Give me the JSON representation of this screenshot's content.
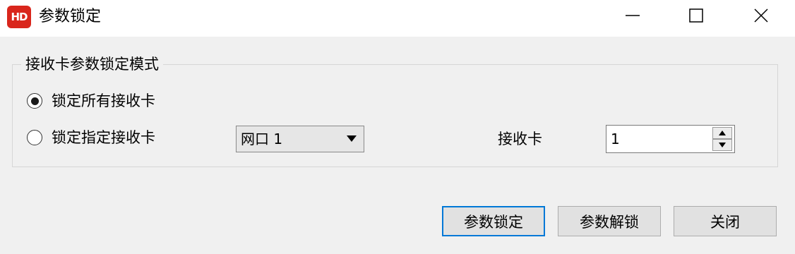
{
  "window": {
    "title": "参数锁定",
    "app_icon_text": "HD",
    "brand_color": "#d9261c"
  },
  "group": {
    "legend": "接收卡参数锁定模式",
    "options": [
      {
        "label": "锁定所有接收卡",
        "selected": true
      },
      {
        "label": "锁定指定接收卡",
        "selected": false
      }
    ],
    "port_select": {
      "value": "网口 1"
    },
    "receiver_card": {
      "label": "接收卡",
      "value": "1"
    }
  },
  "buttons": {
    "lock": "参数锁定",
    "unlock": "参数解锁",
    "close": "关闭",
    "focus_color": "#0078d7"
  },
  "icons": {
    "minimize": "minimize-icon",
    "maximize": "maximize-icon",
    "close": "close-icon",
    "dropdown": "triangle-down-icon",
    "spin_up": "triangle-up-icon",
    "spin_down": "triangle-down-icon"
  }
}
